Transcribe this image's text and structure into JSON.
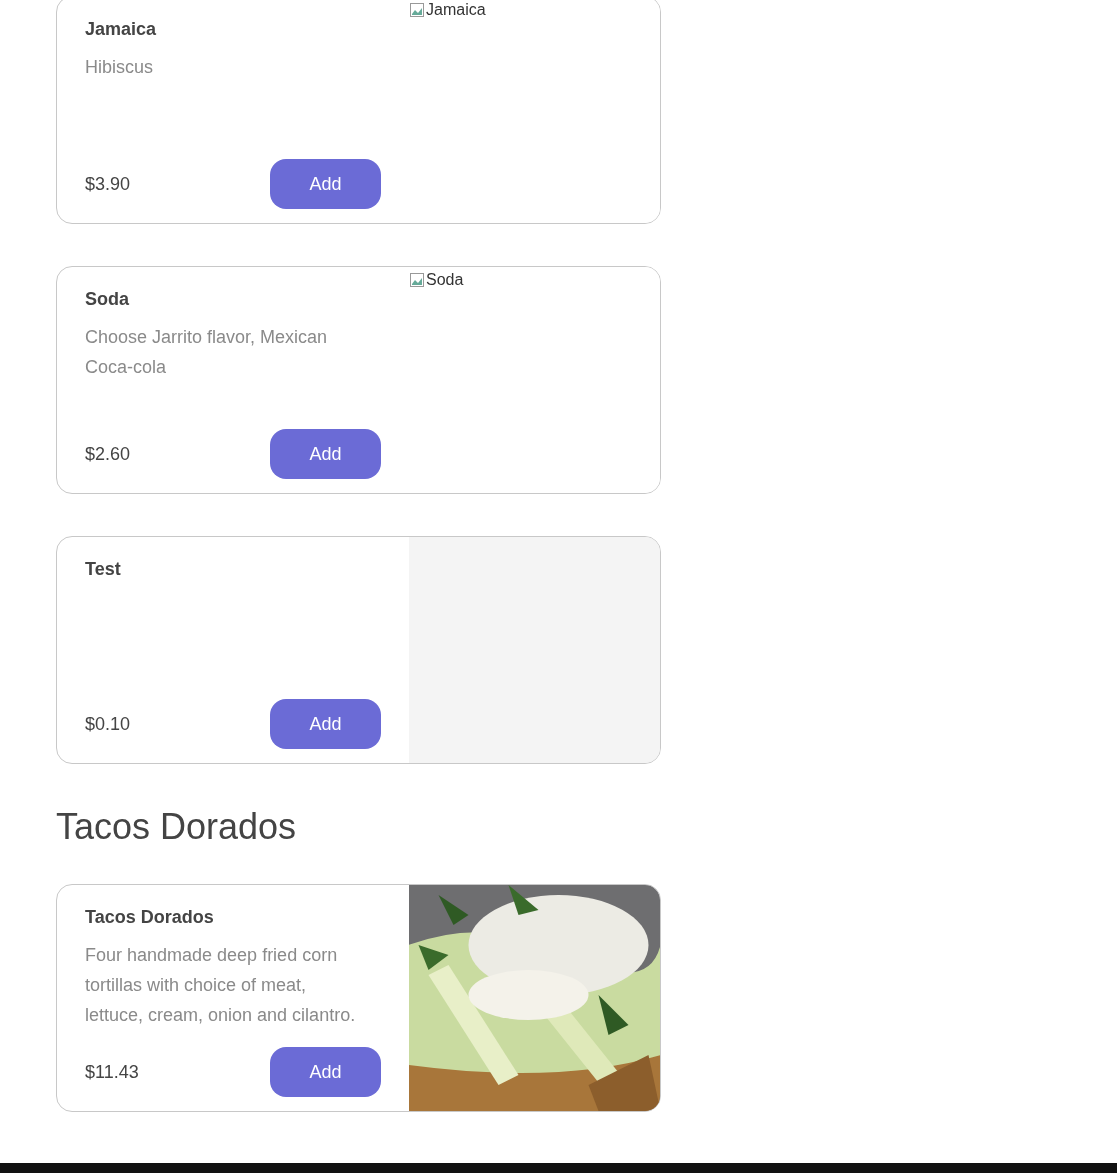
{
  "items": [
    {
      "name": "Jamaica",
      "description": "Hibiscus",
      "price": "$3.90",
      "button": "Add",
      "image": {
        "kind": "broken",
        "alt": "Jamaica"
      }
    },
    {
      "name": "Soda",
      "description": "Choose Jarrito flavor, Mexican Coca-cola",
      "price": "$2.60",
      "button": "Add",
      "image": {
        "kind": "broken",
        "alt": "Soda"
      }
    },
    {
      "name": "Test",
      "price": "$0.10",
      "button": "Add",
      "image": {
        "kind": "empty"
      }
    }
  ],
  "sections": [
    {
      "heading": "Tacos Dorados",
      "items": [
        {
          "name": "Tacos Dorados",
          "description": "Four handmade deep fried corn tortillas with choice of meat, lettuce, cream, onion and cilantro.",
          "price": "$11.43",
          "button": "Add"
        }
      ]
    }
  ]
}
